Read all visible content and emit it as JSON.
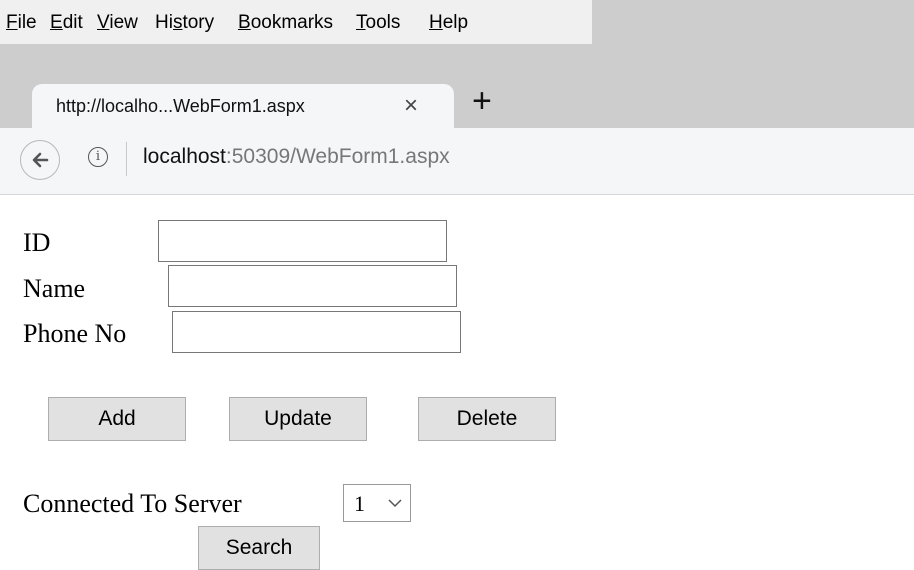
{
  "menu": [
    {
      "pre": "",
      "u": "F",
      "post": "ile"
    },
    {
      "pre": "",
      "u": "E",
      "post": "dit"
    },
    {
      "pre": "",
      "u": "V",
      "post": "iew"
    },
    {
      "pre": "Hi",
      "u": "s",
      "post": "tory"
    },
    {
      "pre": "",
      "u": "B",
      "post": "ookmarks"
    },
    {
      "pre": "",
      "u": "T",
      "post": "ools"
    },
    {
      "pre": "",
      "u": "H",
      "post": "elp"
    }
  ],
  "tab": {
    "title": "http://localho...WebForm1.aspx",
    "close": "×",
    "new": "+"
  },
  "address": {
    "host": "localhost",
    "rest": ":50309/WebForm1.aspx",
    "info": "i"
  },
  "form": {
    "id_label": "ID",
    "id_value": "",
    "name_label": "Name",
    "name_value": "",
    "phone_label": "Phone No",
    "phone_value": ""
  },
  "buttons": {
    "add": "Add",
    "update": "Update",
    "delete": "Delete",
    "search": "Search"
  },
  "server": {
    "label": "Connected To Server",
    "selected": "1"
  },
  "colors": {
    "menubar": "#f0f0f0",
    "tabstrip": "#cdcdcd",
    "button": "#e1e1e1"
  }
}
